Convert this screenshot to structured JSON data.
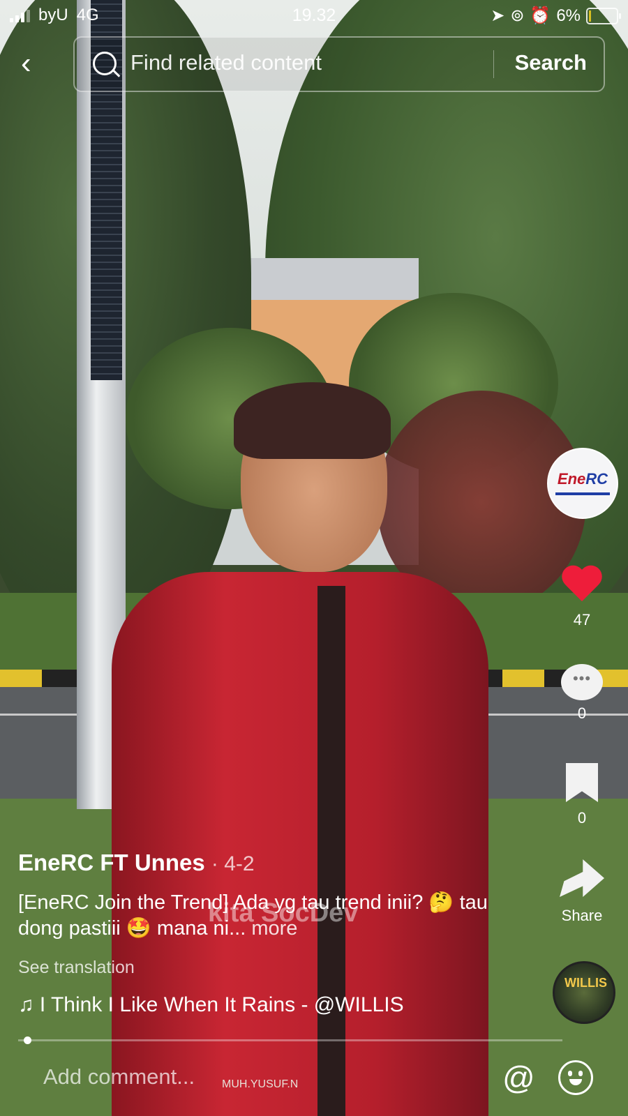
{
  "status_bar": {
    "carrier": "byU",
    "network": "4G",
    "time": "19.32",
    "battery": "6%"
  },
  "search": {
    "placeholder": "Find related content",
    "button_label": "Search"
  },
  "creator_avatar": {
    "logo_primary": "Ene",
    "logo_secondary": "RC"
  },
  "actions": {
    "likes": "47",
    "comments": "0",
    "saves": "0",
    "share_label": "Share"
  },
  "post": {
    "author": "EneRC FT Unnes",
    "date": "· 4-2",
    "caption": "[EneRC Join the Trend] Ada yg tau trend inii? 🤔  tau dong pastiii 🤩 mana ni...",
    "more_label": "more",
    "see_translation": "See translation",
    "music": "♫ I Think I Like When It Rains - @WILLIS",
    "music_disc_label": "WILLIS",
    "watermark": "kita SocDev",
    "name_tag": "MUH.YUSUF.N"
  },
  "comment_bar": {
    "placeholder": "Add comment...",
    "mention_icon": "@"
  },
  "colors": {
    "like_active": "#ee1d3a"
  },
  "playback_progress": 0.01
}
